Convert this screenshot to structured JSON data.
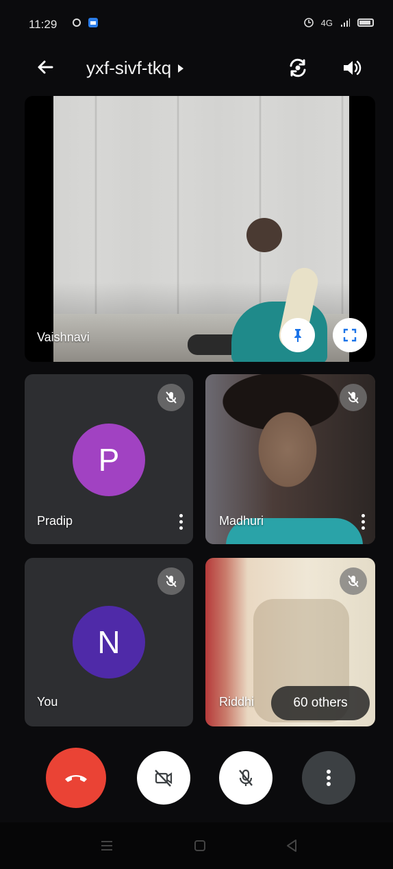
{
  "status_bar": {
    "time": "11:29",
    "network_text": "4G",
    "icons": [
      "sync-icon",
      "app-notification-icon",
      "alarm-icon",
      "signal-icon",
      "battery-icon"
    ]
  },
  "top_bar": {
    "meeting_code": "yxf-sivf-tkq",
    "icons": [
      "back-arrow-icon",
      "chevron-right-icon",
      "switch-camera-icon",
      "speaker-icon"
    ]
  },
  "participants": [
    {
      "name": "Vaishnavi",
      "type": "video",
      "pinned_tile": true
    },
    {
      "name": "Pradip",
      "type": "avatar",
      "initial": "P",
      "avatar_color": "#a142c2",
      "muted": true
    },
    {
      "name": "Madhuri",
      "type": "video",
      "muted": true
    },
    {
      "name": "You",
      "type": "avatar",
      "initial": "N",
      "avatar_color": "#4f2aa8",
      "muted": true
    },
    {
      "name": "Riddhi",
      "type": "video",
      "muted": true
    }
  ],
  "others_label": "60 others",
  "controls": {
    "hangup": "end-call-icon",
    "camera": "camera-off-icon",
    "microphone": "mic-off-icon",
    "more": "more-vert-icon",
    "hangup_color": "#ea4335"
  },
  "nav_bar": {
    "icons": [
      "recent-apps-icon",
      "home-icon",
      "back-icon"
    ]
  }
}
